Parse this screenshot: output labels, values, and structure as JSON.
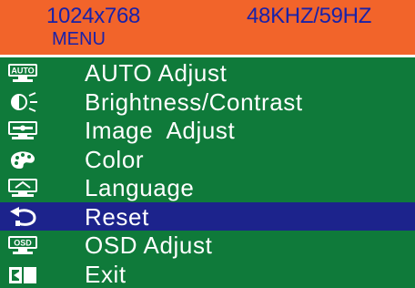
{
  "header": {
    "resolution": "1024x768",
    "frequency": "48KHZ/59HZ",
    "menu_title": "MENU"
  },
  "menu": {
    "items": [
      {
        "label": "AUTO Adjust",
        "icon": "auto-adjust-icon",
        "selected": false
      },
      {
        "label": "Brightness/Contrast",
        "icon": "brightness-contrast-icon",
        "selected": false
      },
      {
        "label": "Image  Adjust",
        "icon": "image-adjust-icon",
        "selected": false
      },
      {
        "label": "Color",
        "icon": "color-palette-icon",
        "selected": false
      },
      {
        "label": "Language",
        "icon": "language-icon",
        "selected": false
      },
      {
        "label": "Reset",
        "icon": "reset-icon",
        "selected": true
      },
      {
        "label": "OSD Adjust",
        "icon": "osd-adjust-icon",
        "selected": false
      },
      {
        "label": "Exit",
        "icon": "exit-icon",
        "selected": false
      }
    ]
  },
  "colors": {
    "menu_background": "#0f7a3a",
    "header_background": "#f2642a",
    "header_text": "#1a22a8",
    "selection_highlight": "#1c238c",
    "item_text": "#ffffff"
  }
}
